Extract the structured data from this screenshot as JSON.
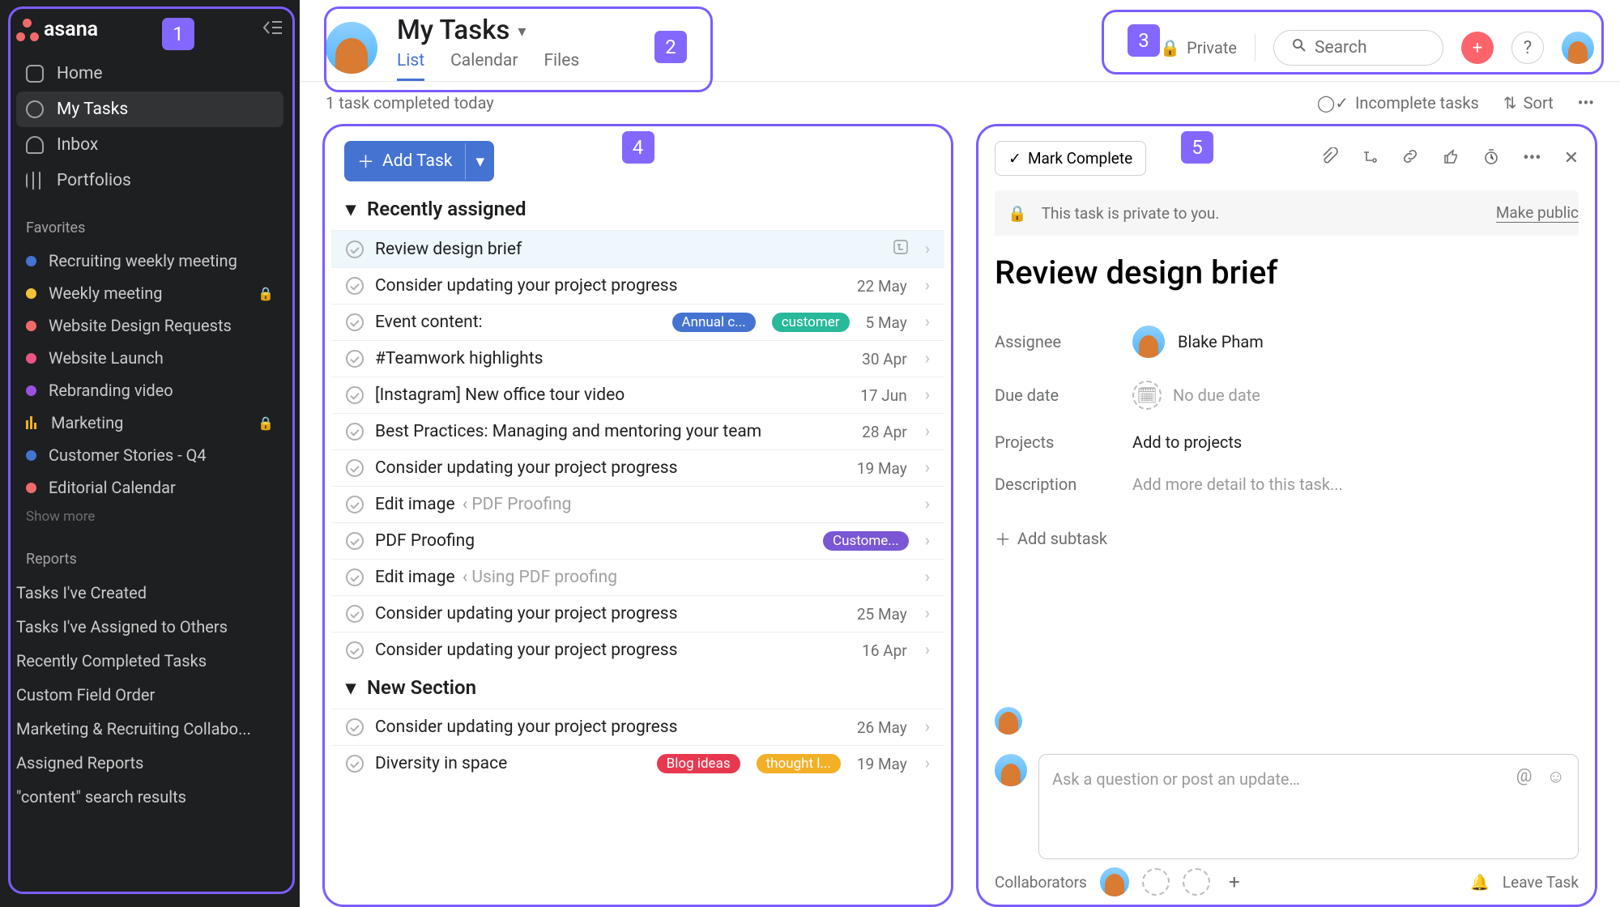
{
  "sidebar": {
    "logo": "asana",
    "nav": [
      {
        "label": "Home"
      },
      {
        "label": "My Tasks"
      },
      {
        "label": "Inbox"
      },
      {
        "label": "Portfolios"
      }
    ],
    "favorites_heading": "Favorites",
    "favorites": [
      {
        "label": "Recruiting weekly meeting",
        "color": "#4573d2",
        "locked": false
      },
      {
        "label": "Weekly meeting",
        "color": "#f2c238",
        "locked": true
      },
      {
        "label": "Website Design Requests",
        "color": "#f06a6a",
        "locked": false
      },
      {
        "label": "Website Launch",
        "color": "#ec5483",
        "locked": false
      },
      {
        "label": "Rebranding video",
        "color": "#9b51e0",
        "locked": false
      },
      {
        "label": "Marketing",
        "color": "bars",
        "locked": true
      },
      {
        "label": "Customer Stories - Q4",
        "color": "#4573d2",
        "locked": false
      },
      {
        "label": "Editorial Calendar",
        "color": "#f06a6a",
        "locked": false
      }
    ],
    "show_more": "Show more",
    "reports_heading": "Reports",
    "reports": [
      "Tasks I've Created",
      "Tasks I've Assigned to Others",
      "Recently Completed Tasks",
      "Custom Field Order",
      "Marketing & Recruiting Collabo...",
      "Assigned Reports",
      "\"content\" search results"
    ]
  },
  "header": {
    "title": "My Tasks",
    "tabs": [
      "List",
      "Calendar",
      "Files"
    ],
    "private": "Private",
    "search_placeholder": "Search"
  },
  "subbar": {
    "status": "1 task completed today",
    "filter": "Incomplete tasks",
    "sort": "Sort"
  },
  "list": {
    "add_task": "Add Task",
    "sections": [
      {
        "name": "Recently assigned",
        "tasks": [
          {
            "title": "Review design brief",
            "date": "",
            "selected": true,
            "icon": "subtasks"
          },
          {
            "title": "Consider updating your project progress",
            "date": "22 May"
          },
          {
            "title": "Event content:",
            "date": "5 May",
            "pills": [
              {
                "text": "Annual c...",
                "color": "#4573d2"
              },
              {
                "text": "customer",
                "color": "#28b99b"
              }
            ]
          },
          {
            "title": "#Teamwork highlights",
            "date": "30 Apr"
          },
          {
            "title": "[Instagram] New office tour video",
            "date": "17 Jun"
          },
          {
            "title": "Best Practices: Managing and mentoring your team",
            "date": "28 Apr"
          },
          {
            "title": "Consider updating your project progress",
            "date": "19 May"
          },
          {
            "title": "Edit image",
            "sub": "‹ PDF Proofing",
            "date": ""
          },
          {
            "title": "PDF Proofing",
            "date": "",
            "pills": [
              {
                "text": "Custome...",
                "color": "#7957d5"
              }
            ]
          },
          {
            "title": "Edit image",
            "sub": "‹ Using PDF proofing",
            "date": ""
          },
          {
            "title": "Consider updating your project progress",
            "date": "25 May"
          },
          {
            "title": "Consider updating your project progress",
            "date": "16 Apr"
          }
        ]
      },
      {
        "name": "New Section",
        "tasks": [
          {
            "title": "Consider updating your project progress",
            "date": "26 May"
          },
          {
            "title": "Diversity in space",
            "date": "19 May",
            "pills": [
              {
                "text": "Blog ideas",
                "color": "#e8384f"
              },
              {
                "text": "thought l...",
                "color": "#f2b027"
              }
            ]
          }
        ]
      }
    ]
  },
  "detail": {
    "mark_complete": "Mark Complete",
    "private_banner": "This task is private to you.",
    "make_public": "Make public",
    "title": "Review design brief",
    "fields": {
      "assignee_label": "Assignee",
      "assignee_value": "Blake Pham",
      "due_label": "Due date",
      "due_placeholder": "No due date",
      "projects_label": "Projects",
      "projects_placeholder": "Add to projects",
      "description_label": "Description",
      "description_placeholder": "Add more detail to this task..."
    },
    "add_subtask": "Add subtask",
    "comment_placeholder": "Ask a question or post an update…",
    "collaborators_label": "Collaborators",
    "leave_task": "Leave Task"
  },
  "overlays": {
    "1": "1",
    "2": "2",
    "3": "3",
    "4": "4",
    "5": "5"
  }
}
